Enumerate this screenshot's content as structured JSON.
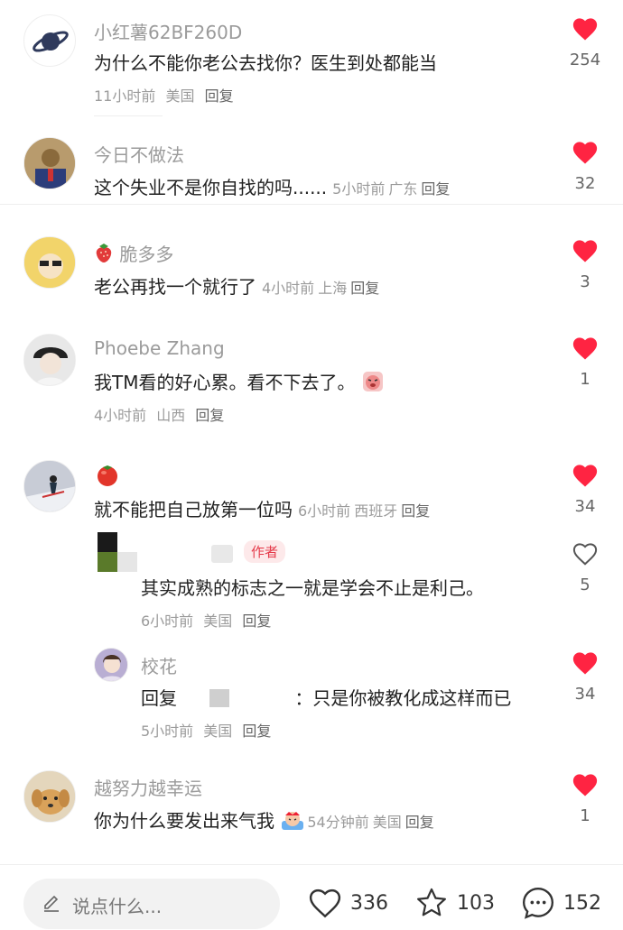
{
  "comments": [
    {
      "user": "小红薯62BF260D",
      "text": "为什么不能你老公去找你？医生到处都能当",
      "time": "11小时前",
      "location": "美国",
      "reply": "回复",
      "likes": "254"
    },
    {
      "user": "今日不做法",
      "text": "这个失业不是你自找的吗......",
      "time": "5小时前",
      "location": "广东",
      "reply": "回复",
      "likes": "32"
    },
    {
      "user": "脆多多",
      "text": "老公再找一个就行了",
      "time": "4小时前",
      "location": "上海",
      "reply": "回复",
      "likes": "3"
    },
    {
      "user": "Phoebe Zhang",
      "text": "我TM看的好心累。看不下去了。",
      "time": "4小时前",
      "location": "山西",
      "reply": "回复",
      "likes": "1"
    },
    {
      "user": "",
      "text": "就不能把自己放第一位吗",
      "time": "6小时前",
      "location": "西班牙",
      "reply": "回复",
      "likes": "34"
    },
    {
      "user": "越努力越幸运",
      "text": "你为什么要发出来气我",
      "time": "54分钟前",
      "location": "美国",
      "reply": "回复",
      "likes": "1"
    }
  ],
  "replies": [
    {
      "user": "",
      "tag": "作者",
      "text": "其实成熟的标志之一就是学会不止是利己。",
      "time": "6小时前",
      "location": "美国",
      "reply": "回复",
      "likes": "5"
    },
    {
      "user": "校花",
      "prefix": "回复",
      "text": "：只是你被教化成这样而已",
      "time": "5小时前",
      "location": "美国",
      "reply": "回复",
      "likes": "34"
    }
  ],
  "bottom": {
    "placeholder": "说点什么...",
    "likes": "336",
    "stars": "103",
    "comments": "152"
  },
  "colors": {
    "heart_red": "#ff2442",
    "text": "#222222",
    "meta": "#9b9b9b"
  }
}
